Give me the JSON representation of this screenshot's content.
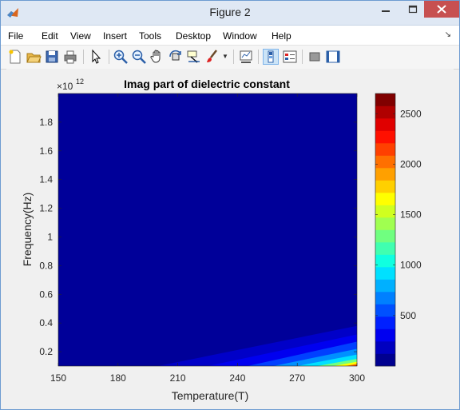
{
  "window": {
    "title": "Figure 2"
  },
  "menu": [
    "File",
    "Edit",
    "View",
    "Insert",
    "Tools",
    "Desktop",
    "Window",
    "Help"
  ],
  "toolbar": {
    "icons": [
      "new-figure-icon",
      "open-file-icon",
      "save-icon",
      "print-icon",
      "edit-plot-arrow-icon",
      "zoom-in-icon",
      "zoom-out-icon",
      "pan-hand-icon",
      "rotate-3d-icon",
      "data-cursor-icon",
      "brush-icon",
      "link-plot-icon",
      "insert-colorbar-icon",
      "insert-legend-icon",
      "hide-plot-tools-icon",
      "show-plot-tools-icon"
    ]
  },
  "chart_data": {
    "type": "heatmap",
    "title": "Imag part of dielectric constant",
    "xlabel": "Temperature(T)",
    "ylabel": "Frequency(Hz)",
    "y_exponent_base": "×10",
    "y_exponent_power": "12",
    "xlim": [
      150,
      300
    ],
    "ylim": [
      0.1,
      2.0
    ],
    "x_ticks": [
      150,
      180,
      210,
      240,
      270,
      300
    ],
    "y_ticks": [
      0.2,
      0.4,
      0.6,
      0.8,
      1,
      1.2,
      1.4,
      1.6,
      1.8
    ],
    "y_tick_labels": [
      "0.2",
      "0.4",
      "0.6",
      "0.8",
      "1",
      "1.2",
      "1.4",
      "1.6",
      "1.8"
    ],
    "colorbar": {
      "range": [
        0,
        2700
      ],
      "ticks": [
        500,
        1000,
        1500,
        2000,
        2500
      ],
      "colors": [
        "#000090",
        "#0000c0",
        "#0000f0",
        "#0020ff",
        "#0050ff",
        "#0080ff",
        "#00b0ff",
        "#00e0ff",
        "#10ffe0",
        "#40ffb0",
        "#70ff80",
        "#a0ff50",
        "#d0ff20",
        "#ffff00",
        "#ffd000",
        "#ffa000",
        "#ff7000",
        "#ff4000",
        "#ff1000",
        "#e00000",
        "#b00000",
        "#800000"
      ]
    },
    "background_level_color": "#000099",
    "hot_region": [
      {
        "level": 200,
        "color": "#0000c8",
        "T_start": 200,
        "F_end_at_300": 0.38
      },
      {
        "level": 400,
        "color": "#0000f0",
        "T_start": 225,
        "F_end_at_300": 0.32
      },
      {
        "level": 600,
        "color": "#0040ff",
        "T_start": 245,
        "F_end_at_300": 0.27
      },
      {
        "level": 800,
        "color": "#0090ff",
        "T_start": 258,
        "F_end_at_300": 0.22
      },
      {
        "level": 1100,
        "color": "#00e0ff",
        "T_start": 270,
        "F_end_at_300": 0.18
      },
      {
        "level": 1500,
        "color": "#70ff80",
        "T_start": 280,
        "F_end_at_300": 0.15
      },
      {
        "level": 1900,
        "color": "#ffff00",
        "T_start": 288,
        "F_end_at_300": 0.13
      },
      {
        "level": 2300,
        "color": "#ff7000",
        "T_start": 294,
        "F_end_at_300": 0.115
      },
      {
        "level": 2650,
        "color": "#c00000",
        "T_start": 297,
        "F_end_at_300": 0.105
      }
    ]
  }
}
